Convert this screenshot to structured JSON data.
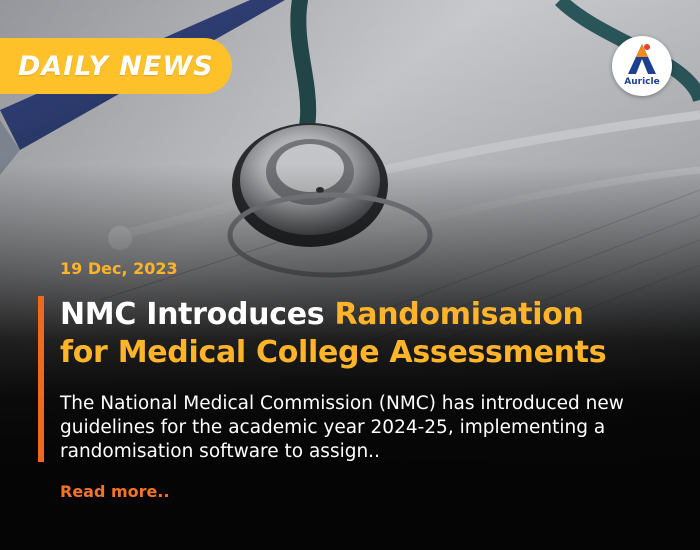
{
  "badge": {
    "label": "DAILY NEWS"
  },
  "logo": {
    "name": "Auricle"
  },
  "article": {
    "date": "19 Dec, 2023",
    "headline_plain": "NMC Introduces ",
    "headline_highlight_1": "Randomisation",
    "headline_highlight_2": "for Medical College Assessments",
    "summary": "The National Medical Commission (NMC) has introduced new guidelines for the academic year 2024-25, implementing a randomisation software to assign..",
    "read_more": "Read more.."
  },
  "colors": {
    "badge_bg": "#ffc12a",
    "highlight": "#ffb42a",
    "accent_bar": "#f06a1e",
    "read_more": "#f4742a"
  }
}
